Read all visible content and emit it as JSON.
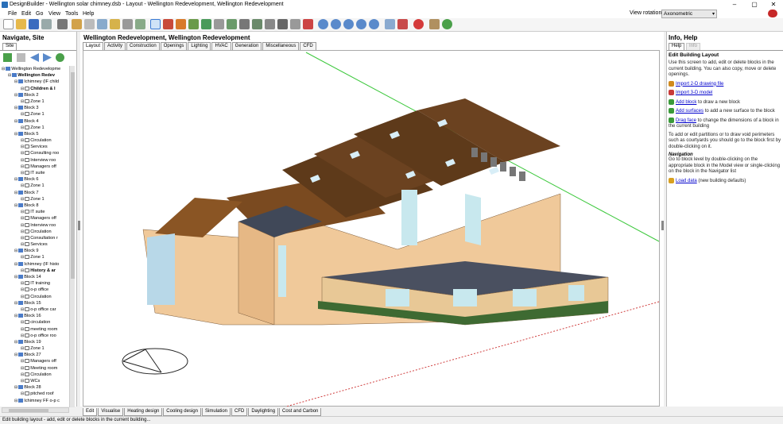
{
  "window": {
    "title": "DesignBuilder - Wellington solar chimney.dsb - Layout - Wellington Redevelopment, Wellington Redevelopment",
    "minimize": "–",
    "maximize": "▢",
    "close": "✕"
  },
  "menu": [
    "File",
    "Edit",
    "Go",
    "View",
    "Tools",
    "Help"
  ],
  "view_rotation": {
    "label": "View rotation",
    "value": "Axonometric"
  },
  "left_panel": {
    "title": "Navigate, Site",
    "tab": "Site",
    "tree": [
      {
        "indent": 0,
        "icon": "site",
        "text": "Wellington Redevelopme"
      },
      {
        "indent": 1,
        "icon": "building",
        "text": "Wellington Redev",
        "bold": true
      },
      {
        "indent": 2,
        "icon": "block",
        "text": "Ichimney (IF child"
      },
      {
        "indent": 3,
        "icon": "zone",
        "text": "Children & I",
        "bold": true
      },
      {
        "indent": 2,
        "icon": "block",
        "text": "Block 2"
      },
      {
        "indent": 3,
        "icon": "zone",
        "text": "Zone 1"
      },
      {
        "indent": 2,
        "icon": "block",
        "text": "Block 3"
      },
      {
        "indent": 3,
        "icon": "zone",
        "text": "Zone 1"
      },
      {
        "indent": 2,
        "icon": "block",
        "text": "Block 4"
      },
      {
        "indent": 3,
        "icon": "zone",
        "text": "Zone 1"
      },
      {
        "indent": 2,
        "icon": "block",
        "text": "Block 5"
      },
      {
        "indent": 3,
        "icon": "zone",
        "text": "Circulation"
      },
      {
        "indent": 3,
        "icon": "zone",
        "text": "Services"
      },
      {
        "indent": 3,
        "icon": "zone",
        "text": "Consulting roo"
      },
      {
        "indent": 3,
        "icon": "zone",
        "text": "Interview roo"
      },
      {
        "indent": 3,
        "icon": "zone",
        "text": "Managers off"
      },
      {
        "indent": 3,
        "icon": "zone",
        "text": "IT suite"
      },
      {
        "indent": 2,
        "icon": "block",
        "text": "Block 6"
      },
      {
        "indent": 3,
        "icon": "zone",
        "text": "Zone 1"
      },
      {
        "indent": 2,
        "icon": "block",
        "text": "Block 7"
      },
      {
        "indent": 3,
        "icon": "zone",
        "text": "Zone 1"
      },
      {
        "indent": 2,
        "icon": "block",
        "text": "Block 8"
      },
      {
        "indent": 3,
        "icon": "zone",
        "text": "IT suite"
      },
      {
        "indent": 3,
        "icon": "zone",
        "text": "Managers off"
      },
      {
        "indent": 3,
        "icon": "zone",
        "text": "Interview roo"
      },
      {
        "indent": 3,
        "icon": "zone",
        "text": "Circulation"
      },
      {
        "indent": 3,
        "icon": "zone",
        "text": "Consultation r"
      },
      {
        "indent": 3,
        "icon": "zone",
        "text": "Services"
      },
      {
        "indent": 2,
        "icon": "block",
        "text": "Block 9"
      },
      {
        "indent": 3,
        "icon": "zone",
        "text": "Zone 1"
      },
      {
        "indent": 2,
        "icon": "block",
        "text": "Ichimney (IF histo"
      },
      {
        "indent": 3,
        "icon": "zone",
        "text": "History & ar",
        "bold": true
      },
      {
        "indent": 2,
        "icon": "block",
        "text": "Block 14"
      },
      {
        "indent": 3,
        "icon": "zone",
        "text": "IT training"
      },
      {
        "indent": 3,
        "icon": "zone",
        "text": "o-p office"
      },
      {
        "indent": 3,
        "icon": "zone",
        "text": "Circulation"
      },
      {
        "indent": 2,
        "icon": "block",
        "text": "Block 15"
      },
      {
        "indent": 3,
        "icon": "zone",
        "text": "o-p office car"
      },
      {
        "indent": 2,
        "icon": "block",
        "text": "Block 16"
      },
      {
        "indent": 3,
        "icon": "zone",
        "text": "circulation"
      },
      {
        "indent": 3,
        "icon": "zone",
        "text": "meeting room"
      },
      {
        "indent": 3,
        "icon": "zone",
        "text": "o-p office roo"
      },
      {
        "indent": 2,
        "icon": "block",
        "text": "Block 19"
      },
      {
        "indent": 3,
        "icon": "zone",
        "text": "Zone 1"
      },
      {
        "indent": 2,
        "icon": "block",
        "text": "Block 27"
      },
      {
        "indent": 3,
        "icon": "zone",
        "text": "Managers off"
      },
      {
        "indent": 3,
        "icon": "zone",
        "text": "Meeting room"
      },
      {
        "indent": 3,
        "icon": "zone",
        "text": "Circulation"
      },
      {
        "indent": 3,
        "icon": "zone",
        "text": "WCs"
      },
      {
        "indent": 2,
        "icon": "block",
        "text": "Block 28"
      },
      {
        "indent": 3,
        "icon": "zone",
        "text": "pitched roof"
      },
      {
        "indent": 2,
        "icon": "block",
        "text": "Ichimney FF o-p c"
      }
    ]
  },
  "center": {
    "title": "Wellington Redevelopment, Wellington Redevelopment",
    "top_tabs": [
      "Layout",
      "Activity",
      "Construction",
      "Openings",
      "Lighting",
      "HVAC",
      "Generation",
      "Miscellaneous",
      "CFD"
    ],
    "selected_top_tab": "Layout",
    "bottom_tabs": [
      "Edit",
      "Visualise",
      "Heating design",
      "Cooling design",
      "Simulation",
      "CFD",
      "Daylighting",
      "Cost and Carbon"
    ],
    "selected_bottom_tab": "Edit"
  },
  "right_panel": {
    "title": "Info, Help",
    "tabs": [
      "Help",
      "Info"
    ],
    "heading": "Edit Building Layout",
    "intro": "Use this screen to add, edit or delete blocks in the current building. You can also copy, move or delete openings.",
    "actions": [
      {
        "link": "Import 2-D drawing file",
        "rest": "",
        "icon_color": "#d08a1e"
      },
      {
        "link": "Import 3-D model",
        "rest": "",
        "icon_color": "#c83a3a"
      },
      {
        "link": "Add block",
        "rest": " to draw a new block",
        "icon_color": "#3a9a3a"
      },
      {
        "link": "Add surfaces",
        "rest": " to add a new surface to the block",
        "icon_color": "#3a9a3a"
      },
      {
        "link": "Drag face",
        "rest": " to change the dimensions of a block in the current building",
        "icon_color": "#3a9a3a"
      }
    ],
    "partitions_text": "To add or edit partitions or to draw void perimeters such as courtyards you should go to the block first by double-clicking on it.",
    "nav_heading": "Navigation",
    "nav_text": "Go to block level by double-clicking on the appropriate block in the Model view or single-clicking on the block in the Navigator list",
    "load_link": "Load data",
    "load_rest": " (new building defaults)"
  },
  "status": "Edit building layout - add, edit or delete blocks in the current building..."
}
